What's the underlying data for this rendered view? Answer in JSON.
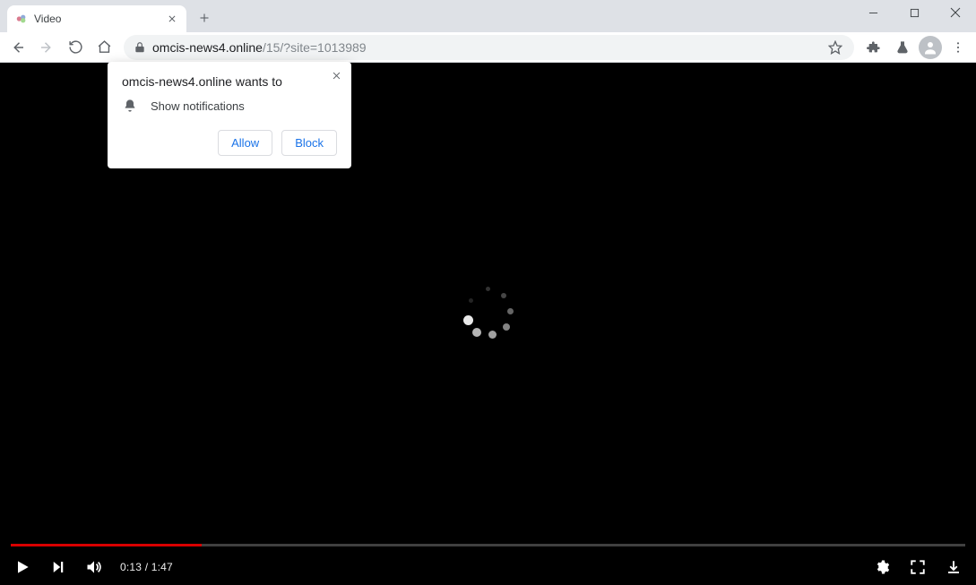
{
  "window": {
    "tab_title": "Video"
  },
  "toolbar": {
    "url_domain": "omcis-news4.online",
    "url_path": "/15/?site=1013989"
  },
  "permission": {
    "heading": "omcis-news4.online wants to",
    "request": "Show notifications",
    "allow": "Allow",
    "block": "Block"
  },
  "player": {
    "current": "0:13",
    "separator": " / ",
    "duration": "1:47",
    "progress_percent": 20
  }
}
